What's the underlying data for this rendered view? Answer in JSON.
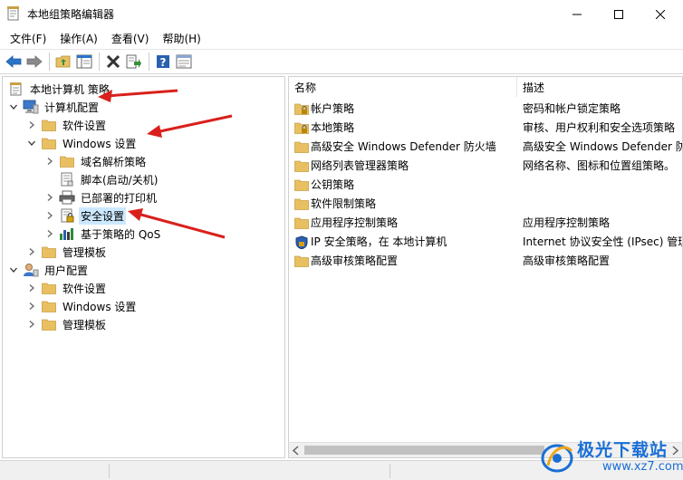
{
  "window": {
    "title": "本地组策略编辑器"
  },
  "menu": [
    "文件(F)",
    "操作(A)",
    "查看(V)",
    "帮助(H)"
  ],
  "tree": [
    {
      "label": "本地计算机 策略",
      "level": 0,
      "expander": "none",
      "icon": "policy-doc"
    },
    {
      "label": "计算机配置",
      "level": 0,
      "expander": "expanded",
      "icon": "computer"
    },
    {
      "label": "软件设置",
      "level": 1,
      "expander": "collapsed",
      "icon": "folder"
    },
    {
      "label": "Windows 设置",
      "level": 1,
      "expander": "expanded",
      "icon": "folder"
    },
    {
      "label": "域名解析策略",
      "level": 2,
      "expander": "collapsed",
      "icon": "folder"
    },
    {
      "label": "脚本(启动/关机)",
      "level": 2,
      "expander": "none",
      "icon": "script"
    },
    {
      "label": "已部署的打印机",
      "level": 2,
      "expander": "collapsed",
      "icon": "printer"
    },
    {
      "label": "安全设置",
      "level": 2,
      "expander": "collapsed",
      "icon": "security",
      "selected": true
    },
    {
      "label": "基于策略的 QoS",
      "level": 2,
      "expander": "collapsed",
      "icon": "qos-chart"
    },
    {
      "label": "管理模板",
      "level": 1,
      "expander": "collapsed",
      "icon": "folder"
    },
    {
      "label": "用户配置",
      "level": 0,
      "expander": "expanded",
      "icon": "user"
    },
    {
      "label": "软件设置",
      "level": 1,
      "expander": "collapsed",
      "icon": "folder"
    },
    {
      "label": "Windows 设置",
      "level": 1,
      "expander": "collapsed",
      "icon": "folder"
    },
    {
      "label": "管理模板",
      "level": 1,
      "expander": "collapsed",
      "icon": "folder"
    }
  ],
  "list": {
    "columns": {
      "name": "名称",
      "desc": "描述"
    },
    "rows": [
      {
        "name": "帐户策略",
        "desc": "密码和帐户锁定策略",
        "icon": "folder-lock"
      },
      {
        "name": "本地策略",
        "desc": "审核、用户权利和安全选项策略",
        "icon": "folder-lock"
      },
      {
        "name": "高级安全 Windows Defender 防火墙",
        "desc": "高级安全 Windows Defender 防",
        "icon": "folder"
      },
      {
        "name": "网络列表管理器策略",
        "desc": "网络名称、图标和位置组策略。",
        "icon": "folder"
      },
      {
        "name": "公钥策略",
        "desc": "",
        "icon": "folder"
      },
      {
        "name": "软件限制策略",
        "desc": "",
        "icon": "folder"
      },
      {
        "name": "应用程序控制策略",
        "desc": "应用程序控制策略",
        "icon": "folder"
      },
      {
        "name": "IP 安全策略，在 本地计算机",
        "desc": "Internet 协议安全性 (IPsec) 管理",
        "icon": "ipsec"
      },
      {
        "name": "高级审核策略配置",
        "desc": "高级审核策略配置",
        "icon": "folder"
      }
    ]
  },
  "watermark": {
    "brand": "极光下载站",
    "url": "www.xz7.com"
  },
  "colors": {
    "folder": "#e8c062",
    "folder_dark": "#c9a043",
    "selection": "#cce8ff",
    "arrow": "#d9201c",
    "watermark": "#1a6fd4"
  }
}
